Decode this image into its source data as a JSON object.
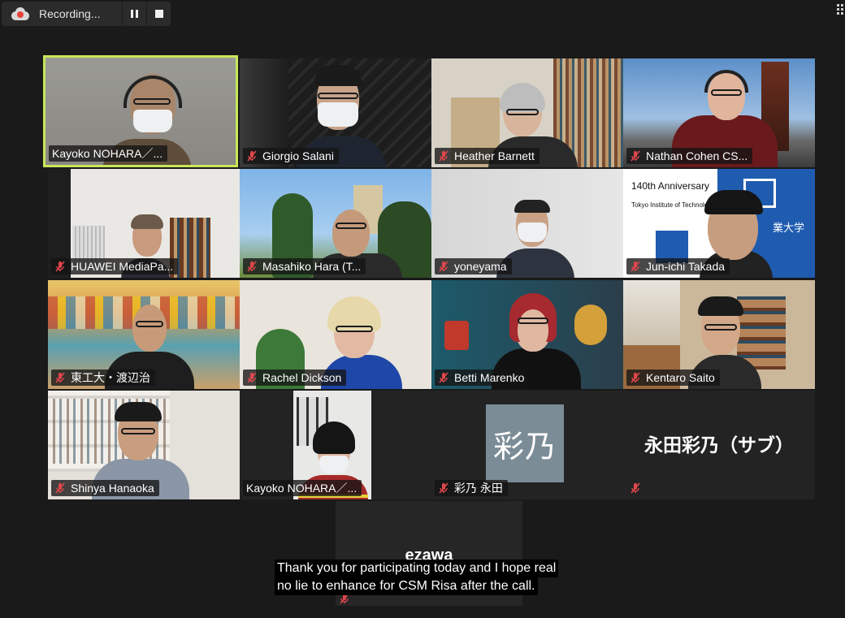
{
  "recording": {
    "label": "Recording...",
    "pause_icon": "pause-icon",
    "stop_icon": "stop-icon"
  },
  "view": {
    "grid_icon": "grid-view-icon"
  },
  "participants": [
    {
      "name": "Kayoko NOHARA／...",
      "active": true,
      "muted": false
    },
    {
      "name": "Giorgio Salani",
      "muted": true
    },
    {
      "name": "Heather Barnett",
      "muted": true
    },
    {
      "name": "Nathan Cohen CS...",
      "muted": true
    },
    {
      "name": "HUAWEI MediaPa...",
      "muted": true
    },
    {
      "name": "Masahiko Hara (T...",
      "muted": true
    },
    {
      "name": "yoneyama",
      "muted": true
    },
    {
      "name": "Jun-ichi Takada",
      "muted": true
    },
    {
      "name": "東工大・渡辺治",
      "muted": true
    },
    {
      "name": "Rachel Dickson",
      "muted": true
    },
    {
      "name": "Betti Marenko",
      "muted": true
    },
    {
      "name": "Kentaro Saito",
      "muted": true
    },
    {
      "name": "Shinya Hanaoka",
      "muted": true
    },
    {
      "name": "Kayoko NOHARA／...",
      "muted": false
    },
    {
      "name": "彩乃 永田",
      "muted": true,
      "avatar_text": "彩乃"
    },
    {
      "name": "",
      "muted": true,
      "display_name": "永田彩乃（サブ）"
    }
  ],
  "tile15_badge": "140th Anniversary",
  "tile15_sub": "Tokyo Institute of Technology",
  "tile15_jp": "業大学",
  "floating_tile": {
    "name": "ezawa",
    "muted": true
  },
  "captions": {
    "line1": "Thank you for participating today and I hope real",
    "line2": "no lie to enhance for CSM Risa after the call."
  },
  "colors": {
    "background": "#1a1a1a",
    "active_speaker_border": "#c8e65a",
    "mute_red": "#e0474c",
    "avatar_bg": "#7b8c96"
  }
}
